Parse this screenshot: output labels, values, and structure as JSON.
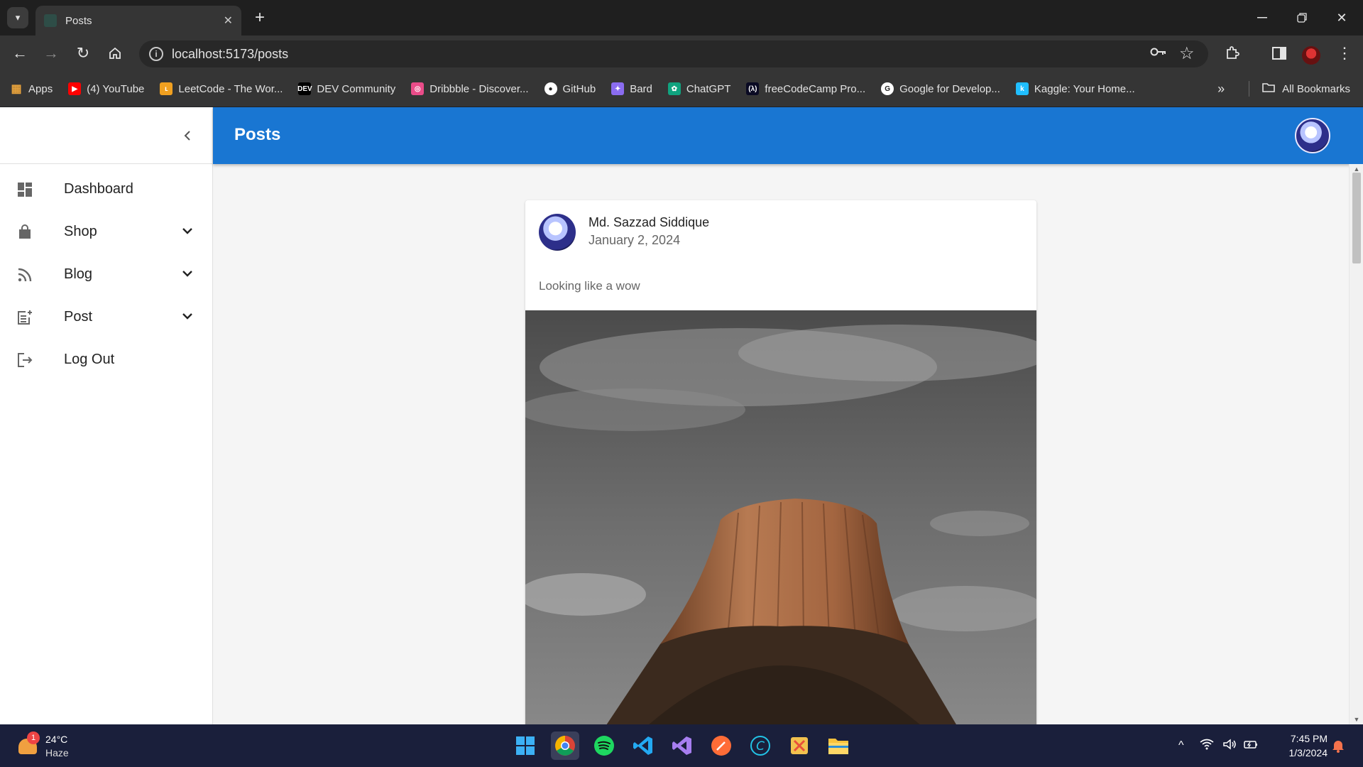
{
  "browser": {
    "tab_title": "Posts",
    "url": "localhost:5173/posts",
    "bookmarks": [
      {
        "label": "Apps",
        "icon": "apps-grid-icon",
        "color": "#4285f4"
      },
      {
        "label": "(4) YouTube",
        "icon": "youtube-icon",
        "color": "#ff0000"
      },
      {
        "label": "LeetCode - The Wor...",
        "icon": "leetcode-icon",
        "color": "#f0a020"
      },
      {
        "label": "DEV Community",
        "icon": "dev-icon",
        "color": "#000000"
      },
      {
        "label": "Dribbble - Discover...",
        "icon": "dribbble-icon",
        "color": "#ea4c89"
      },
      {
        "label": "GitHub",
        "icon": "github-icon",
        "color": "#ffffff"
      },
      {
        "label": "Bard",
        "icon": "bard-icon",
        "color": "#8a6cf0"
      },
      {
        "label": "ChatGPT",
        "icon": "chatgpt-icon",
        "color": "#10a37f"
      },
      {
        "label": "freeCodeCamp Pro...",
        "icon": "freecodecamp-icon",
        "color": "#0a0a23"
      },
      {
        "label": "Google for Develop...",
        "icon": "google-icon",
        "color": "#ffffff"
      },
      {
        "label": "Kaggle: Your Home...",
        "icon": "kaggle-icon",
        "color": "#20beff"
      }
    ],
    "all_bookmarks": "All Bookmarks"
  },
  "app": {
    "page_title": "Posts",
    "accent_color": "#1976d2",
    "nav": [
      {
        "label": "Dashboard",
        "icon": "dashboard-icon",
        "expandable": false
      },
      {
        "label": "Shop",
        "icon": "shopping-bag-icon",
        "expandable": true
      },
      {
        "label": "Blog",
        "icon": "rss-feed-icon",
        "expandable": true
      },
      {
        "label": "Post",
        "icon": "post-add-icon",
        "expandable": true
      },
      {
        "label": "Log Out",
        "icon": "logout-icon",
        "expandable": false
      }
    ],
    "post": {
      "author": "Md. Sazzad Siddique",
      "date": "January 2, 2024",
      "text": "Looking like a wow"
    }
  },
  "taskbar": {
    "weather_temp": "24°C",
    "weather_condition": "Haze",
    "weather_badge": "1",
    "time": "7:45 PM",
    "date": "1/3/2024"
  }
}
